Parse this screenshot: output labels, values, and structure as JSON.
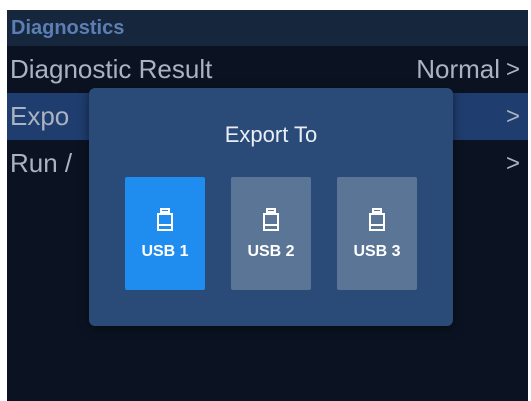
{
  "section": {
    "title": "Diagnostics"
  },
  "menu": {
    "items": [
      {
        "label": "Diagnostic Result",
        "value": "Normal",
        "chevron": ">"
      },
      {
        "label": "Expo",
        "value": "",
        "chevron": ">"
      },
      {
        "label": "Run /",
        "value": "",
        "chevron": ">"
      }
    ]
  },
  "dialog": {
    "title": "Export To",
    "options": [
      {
        "label": "USB 1",
        "icon": "usb-drive-icon",
        "selected": true
      },
      {
        "label": "USB 2",
        "icon": "usb-drive-icon",
        "selected": false
      },
      {
        "label": "USB 3",
        "icon": "usb-drive-icon",
        "selected": false
      }
    ]
  },
  "colors": {
    "background": "#0b1322",
    "header": "#16263d",
    "selected_row": "#1f3d6e",
    "dialog": "#2a4b78",
    "option": "#5a7596",
    "option_selected": "#1f8cf0"
  }
}
